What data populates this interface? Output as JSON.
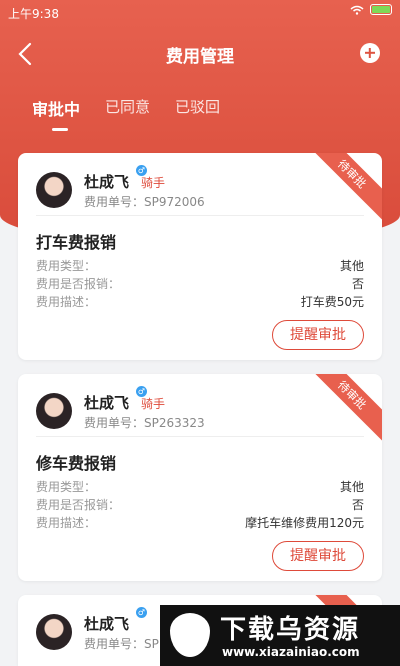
{
  "status_bar": {
    "time": "上午9:38"
  },
  "header": {
    "title": "费用管理"
  },
  "tabs": [
    {
      "label": "审批中",
      "active": true
    },
    {
      "label": "已同意",
      "active": false
    },
    {
      "label": "已驳回",
      "active": false
    }
  ],
  "colors": {
    "brand": "#de5442",
    "accent_text": "#de4a3a"
  },
  "cards": [
    {
      "name": "杜成飞",
      "role": "骑手",
      "order_no": "费用单号：SP972006",
      "stamp": "待审批",
      "title": "打车费报销",
      "fields": [
        {
          "key": "费用类型：",
          "value": "其他"
        },
        {
          "key": "费用是否报销：",
          "value": "否"
        },
        {
          "key": "费用描述：",
          "value": "打车费50元"
        }
      ],
      "button": "提醒审批"
    },
    {
      "name": "杜成飞",
      "role": "骑手",
      "order_no": "费用单号：SP263323",
      "stamp": "待审批",
      "title": "修车费报销",
      "fields": [
        {
          "key": "费用类型：",
          "value": "其他"
        },
        {
          "key": "费用是否报销：",
          "value": "否"
        },
        {
          "key": "费用描述：",
          "value": "摩托车维修费用120元"
        }
      ],
      "button": "提醒审批"
    },
    {
      "name": "杜成飞",
      "order_no": "费用单号：SP",
      "stamp": "待"
    }
  ],
  "watermark": {
    "title": "下载乌资源",
    "url": "www.xiazainiao.com"
  }
}
